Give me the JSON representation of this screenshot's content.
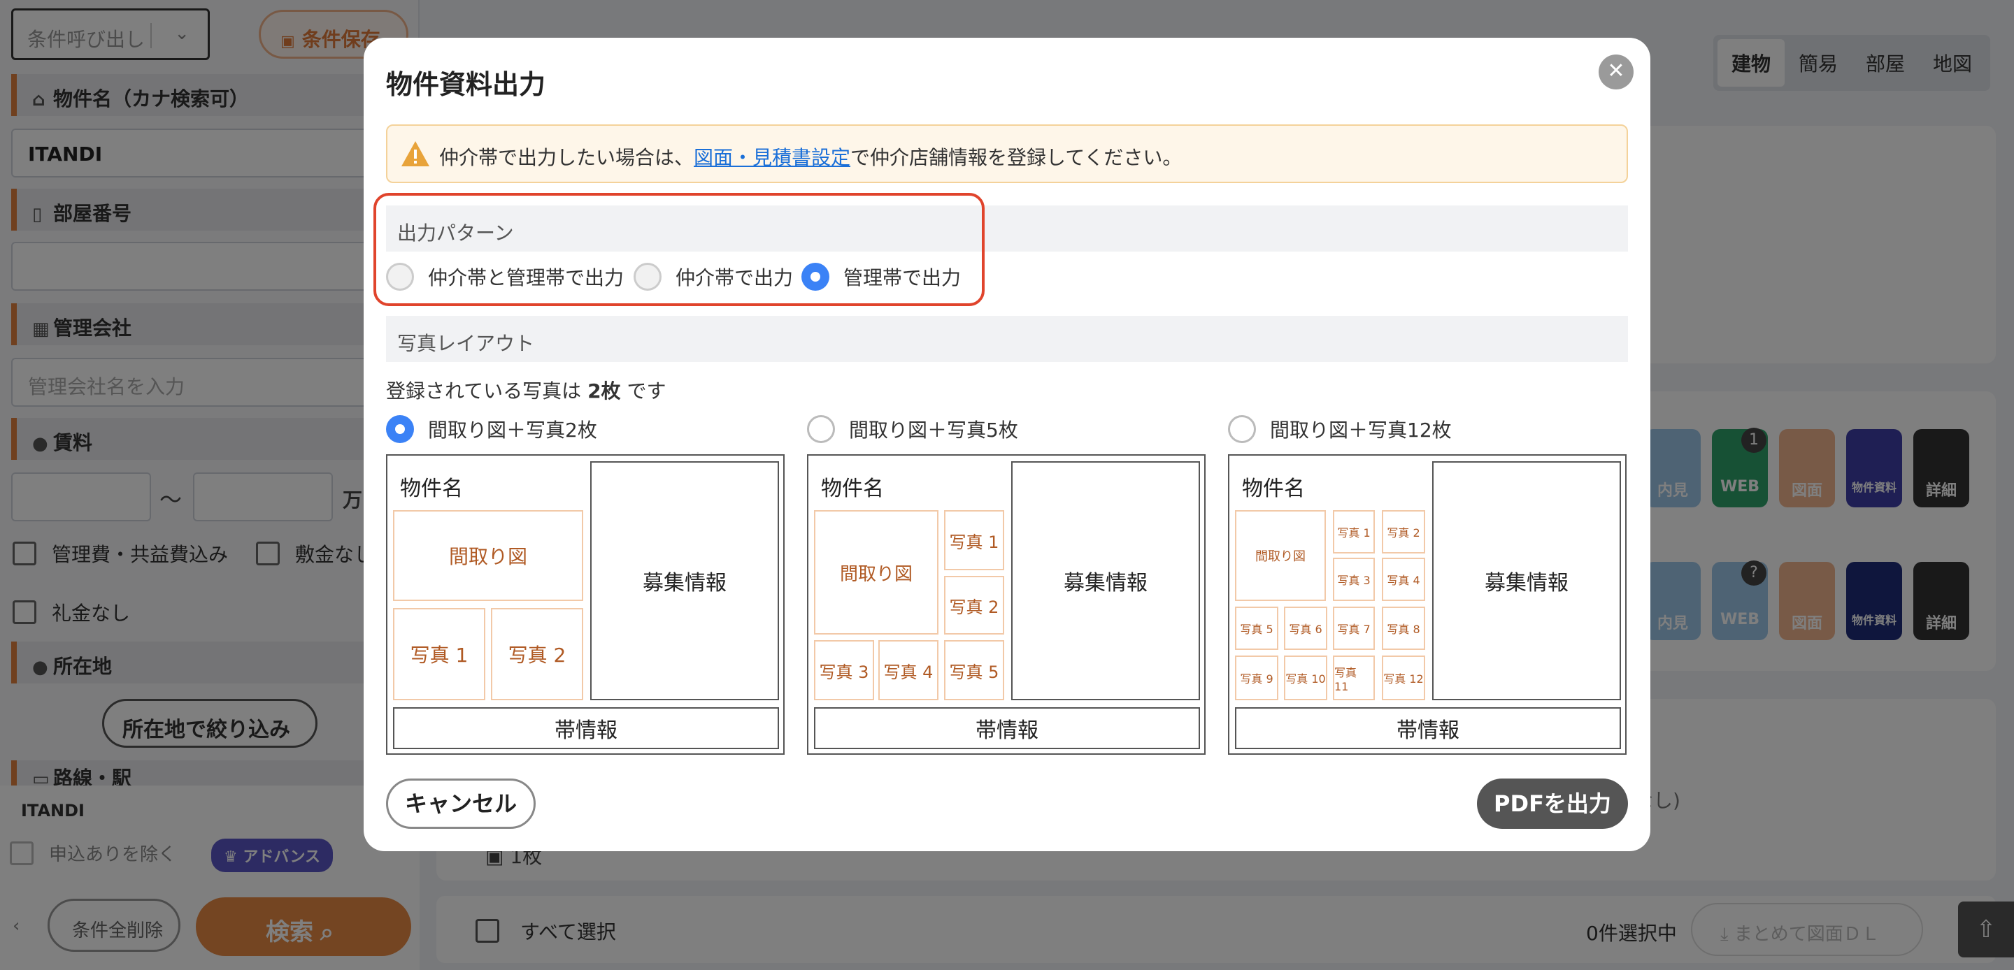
{
  "sidebar": {
    "condition_select_placeholder": "条件呼び出し",
    "save_condition_label": "条件保存",
    "property_name_label": "物件名（カナ検索可）",
    "property_name_value": "ITANDI",
    "room_number_label": "部屋番号",
    "management_company_label": "管理会社",
    "management_company_placeholder": "管理会社名を入力",
    "rent_label": "賃料",
    "rent_range_sep": "〜",
    "rent_unit": "万",
    "include_fees_label": "管理費・共益費込み",
    "no_deposit_label": "敷金なし",
    "no_key_money_label": "礼金なし",
    "location_label": "所在地",
    "location_filter_button": "所在地で絞り込み",
    "line_station_label": "路線・駅",
    "footer_company": "ITANDI",
    "exclude_applied_label": "申込ありを除く",
    "advance_badge": "アドバンス",
    "clear_all_button": "条件全削除",
    "search_button": "検索"
  },
  "main": {
    "view_tabs": [
      "建物",
      "簡易",
      "部屋",
      "地図"
    ],
    "active_view_tab": "建物",
    "row1_actions": {
      "web": "WEB",
      "web_badge": "1",
      "materials": "物件資料",
      "detail": "詳細",
      "interior": "内見",
      "floorplan": "図面"
    },
    "row2_actions": {
      "web": "WEB",
      "web_badge": "?",
      "materials": "物件資料",
      "detail": "詳細",
      "interior": "内見",
      "floorplan": "図面"
    },
    "partial_text_nashi": "なし)",
    "partial_text_count": "1枚",
    "select_all_label": "すべて選択",
    "selected_count": "0件選択中",
    "bulk_download_button": "まとめて図面ＤＬ"
  },
  "modal": {
    "title": "物件資料出力",
    "notice_prefix": "仲介帯で出力したい場合は、",
    "notice_link": "図面・見積書設定",
    "notice_suffix": "で仲介店舗情報を登録してください。",
    "output_pattern_heading": "出力パターン",
    "output_patterns": [
      "仲介帯と管理帯で出力",
      "仲介帯で出力",
      "管理帯で出力"
    ],
    "selected_output_pattern": "管理帯で出力",
    "photo_layout_heading": "写真レイアウト",
    "registered_photos_prefix": "登録されている写真は ",
    "registered_photos_count": "2枚",
    "registered_photos_suffix": " です",
    "layouts": [
      {
        "label": "間取り図＋写真2枚",
        "selected": true
      },
      {
        "label": "間取り図＋写真5枚",
        "selected": false
      },
      {
        "label": "間取り図＋写真12枚",
        "selected": false
      }
    ],
    "preview": {
      "property_name": "物件名",
      "floorplan": "間取り図",
      "recruitment_info": "募集情報",
      "band_info": "帯情報",
      "photos": [
        "写真 1",
        "写真 2",
        "写真 3",
        "写真 4",
        "写真 5"
      ],
      "photos_small": [
        "写真 1",
        "写真 2",
        "写真 3",
        "写真 4",
        "写真 5",
        "写真 6",
        "写真 7",
        "写真 8",
        "写真 9",
        "写真 10",
        "写真 11",
        "写真 12"
      ]
    },
    "cancel_button": "キャンセル",
    "pdf_button": "PDFを出力"
  }
}
